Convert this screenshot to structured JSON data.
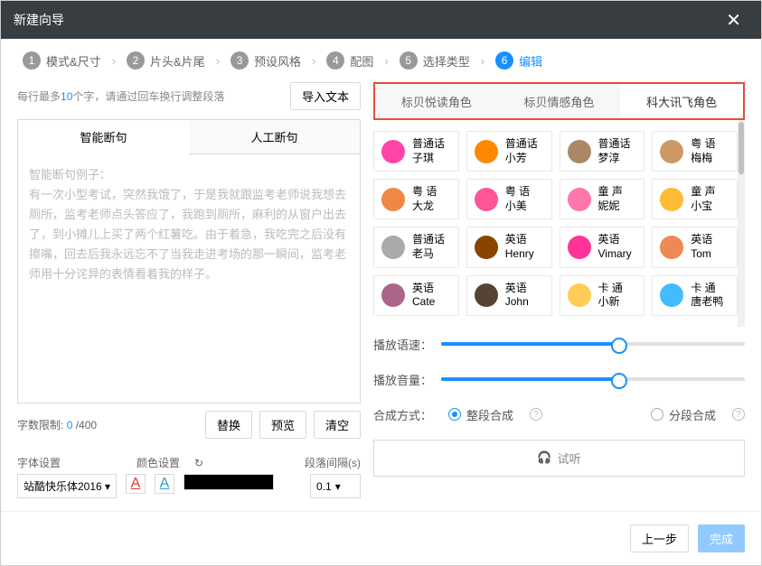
{
  "title": "新建向导",
  "steps": [
    {
      "num": "1",
      "label": "模式&尺寸"
    },
    {
      "num": "2",
      "label": "片头&片尾"
    },
    {
      "num": "3",
      "label": "预设风格"
    },
    {
      "num": "4",
      "label": "配图"
    },
    {
      "num": "5",
      "label": "选择类型"
    },
    {
      "num": "6",
      "label": "编辑"
    }
  ],
  "left": {
    "hint_pre": "每行最多",
    "hint_num": "10",
    "hint_post": "个字，请通过回车换行调整段落",
    "import": "导入文本",
    "tabs": {
      "smart": "智能断句",
      "manual": "人工断句"
    },
    "placeholder": "智能断句例子：\n有一次小型考试，突然我饿了，于是我就跟监考老师说我想去厕所，监考老师点头答应了，我跑到厕所，麻利的从窗户出去了，到小摊儿上买了两个红薯吃。由于着急，我吃完之后没有擦嘴，回去后我永远忘不了当我走进考场的那一瞬间，监考老师用十分诧异的表情看着我的样子。",
    "count_label": "字数限制:",
    "count_val": "0",
    "count_max": "/400",
    "btn_replace": "替换",
    "btn_preview": "预览",
    "btn_clear": "清空",
    "font_label": "字体设置",
    "color_label": "颜色设置",
    "gap_label": "段落间隔(s)",
    "font_value": "站酷快乐体2016",
    "gap_value": "0.1"
  },
  "right": {
    "role_tabs": [
      "标贝悦读角色",
      "标贝情感角色",
      "科大讯飞角色"
    ],
    "voices": [
      {
        "lang": "普通话",
        "name": "子琪",
        "c": "#f4a"
      },
      {
        "lang": "普通话",
        "name": "小芳",
        "c": "#f80"
      },
      {
        "lang": "普通话",
        "name": "梦淳",
        "c": "#a86"
      },
      {
        "lang": "粤 语",
        "name": "梅梅",
        "c": "#c96"
      },
      {
        "lang": "粤 语",
        "name": "大龙",
        "c": "#e84"
      },
      {
        "lang": "粤 语",
        "name": "小美",
        "c": "#f59"
      },
      {
        "lang": "童 声",
        "name": "妮妮",
        "c": "#f7a"
      },
      {
        "lang": "童 声",
        "name": "小宝",
        "c": "#fb3"
      },
      {
        "lang": "普通话",
        "name": "老马",
        "c": "#aaa"
      },
      {
        "lang": "英语",
        "name": "Henry",
        "c": "#840"
      },
      {
        "lang": "英语",
        "name": "Vimary",
        "c": "#f39"
      },
      {
        "lang": "英语",
        "name": "Tom",
        "c": "#e85"
      },
      {
        "lang": "英语",
        "name": "Cate",
        "c": "#a68"
      },
      {
        "lang": "英语",
        "name": "John",
        "c": "#543"
      },
      {
        "lang": "卡 通",
        "name": "小新",
        "c": "#fc5"
      },
      {
        "lang": "卡 通",
        "name": "唐老鸭",
        "c": "#4bf"
      }
    ],
    "speed_label": "播放语速：",
    "volume_label": "播放音量：",
    "synth_label": "合成方式：",
    "opt_whole": "整段合成",
    "opt_seg": "分段合成",
    "preview": "试听"
  },
  "footer": {
    "prev": "上一步",
    "done": "完成"
  }
}
